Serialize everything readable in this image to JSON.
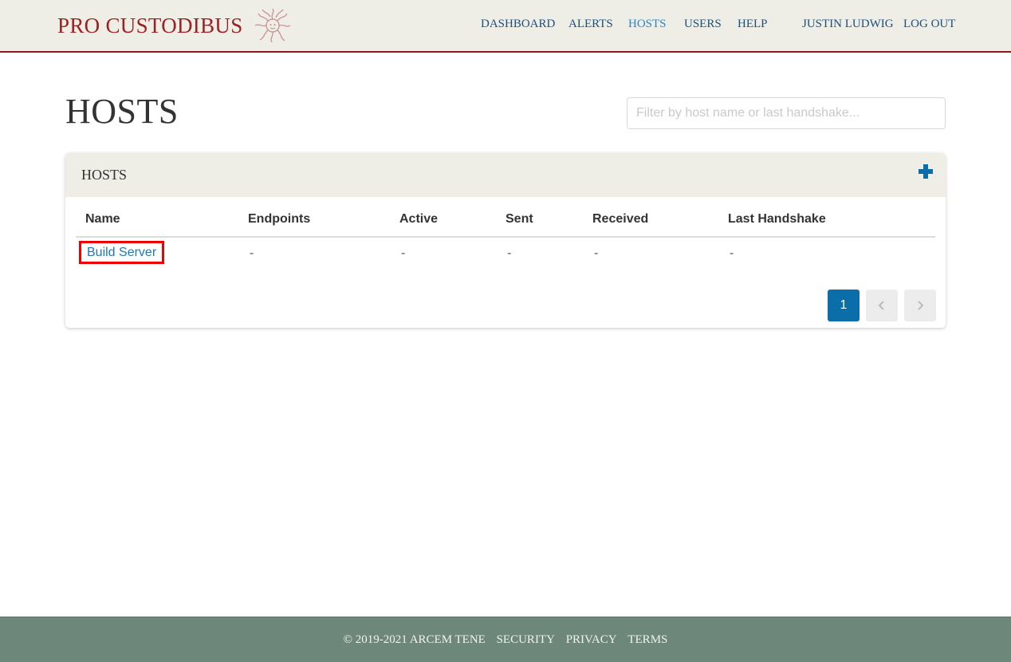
{
  "brand": {
    "name": "PRO CUSTODIBUS",
    "logo_icon": "medusa-head-logo",
    "color": "#9b2222"
  },
  "nav": {
    "items": [
      {
        "label": "DASHBOARD",
        "active": false
      },
      {
        "label": "ALERTS",
        "active": false
      },
      {
        "label": "HOSTS",
        "active": true
      },
      {
        "label": "USERS",
        "active": false
      },
      {
        "label": "HELP",
        "active": false
      }
    ],
    "user": "JUSTIN LUDWIG",
    "logout": "LOG OUT"
  },
  "page": {
    "title": "HOSTS",
    "filter": {
      "value": "",
      "placeholder": "Filter by host name or last handshake..."
    }
  },
  "panel": {
    "title": "HOSTS",
    "add_icon": "plus-icon",
    "table": {
      "columns": [
        "Name",
        "Endpoints",
        "Active",
        "Sent",
        "Received",
        "Last Handshake"
      ],
      "rows": [
        {
          "name": "Build Server",
          "endpoints": "-",
          "active": "-",
          "sent": "-",
          "received": "-",
          "last_handshake": "-"
        }
      ]
    },
    "pagination": {
      "current_page": "1",
      "prev_icon": "chevron-left-icon",
      "next_icon": "chevron-right-icon"
    }
  },
  "footer": {
    "copyright": "© 2019-2021 ARCEM TENE",
    "links": [
      "SECURITY",
      "PRIVACY",
      "TERMS"
    ]
  },
  "colors": {
    "accent": "#0b6ea8",
    "link": "#1f77b4",
    "nav_link": "#1d4f7c",
    "nav_active": "#2a86bd",
    "header_bg": "#eeede6",
    "footer_bg": "#6d887b",
    "highlight": "#ee0000"
  }
}
